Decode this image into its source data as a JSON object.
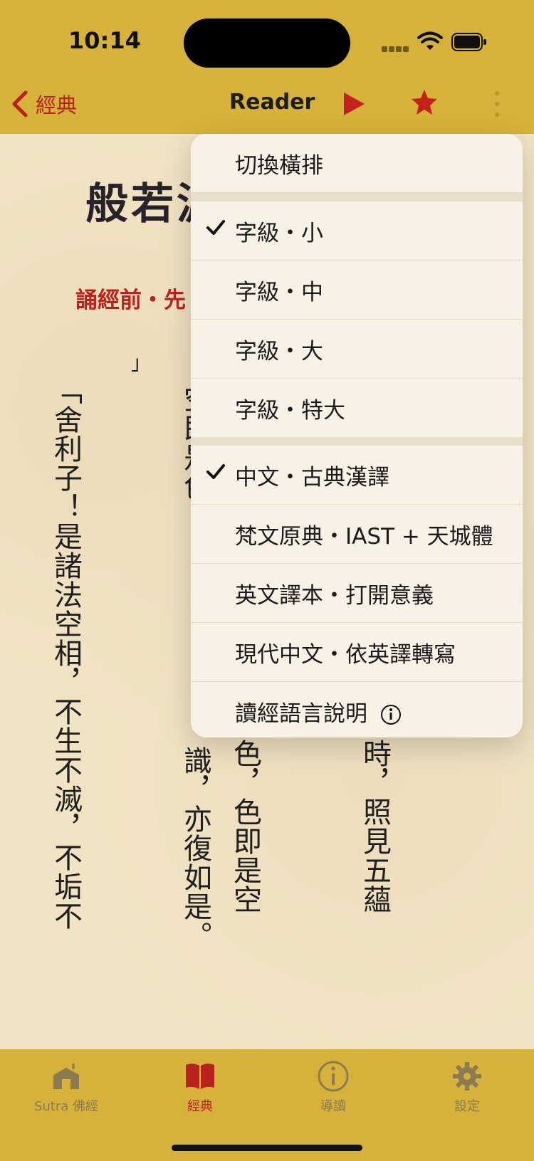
{
  "status": {
    "time": "10:14"
  },
  "nav": {
    "back_label": "經典",
    "title": "Reader"
  },
  "content": {
    "title": "般若波",
    "before_reading": "誦經前・先",
    "bracket": "」",
    "columns": [
      "「舍利子！是諸法空相，不生不滅，不垢不",
      "空即是色",
      "識，亦復如是。",
      "色，色即是空",
      "時，照見五蘊"
    ]
  },
  "menu": {
    "items": [
      {
        "label": "切換橫排",
        "checked": false
      },
      {
        "label": "字級・小",
        "checked": true
      },
      {
        "label": "字級・中",
        "checked": false
      },
      {
        "label": "字級・大",
        "checked": false
      },
      {
        "label": "字級・特大",
        "checked": false
      },
      {
        "label": "中文・古典漢譯",
        "checked": true
      },
      {
        "label": "梵文原典・IAST + 天城體",
        "checked": false
      },
      {
        "label": "英文譯本・打開意義",
        "checked": false
      },
      {
        "label": "現代中文・依英譯轉寫",
        "checked": false
      },
      {
        "label": "讀經語言說明",
        "checked": false
      }
    ]
  },
  "tabs": [
    {
      "label": "Sutra 佛經",
      "icon": "temple-icon",
      "active": false
    },
    {
      "label": "經典",
      "icon": "book-icon",
      "active": true
    },
    {
      "label": "導讀",
      "icon": "info-icon",
      "active": false
    },
    {
      "label": "設定",
      "icon": "gear-icon",
      "active": false
    }
  ],
  "colors": {
    "accent_red": "#B9231E",
    "bar_gold": "#D6B23A",
    "paper": "#F1E4C4"
  }
}
